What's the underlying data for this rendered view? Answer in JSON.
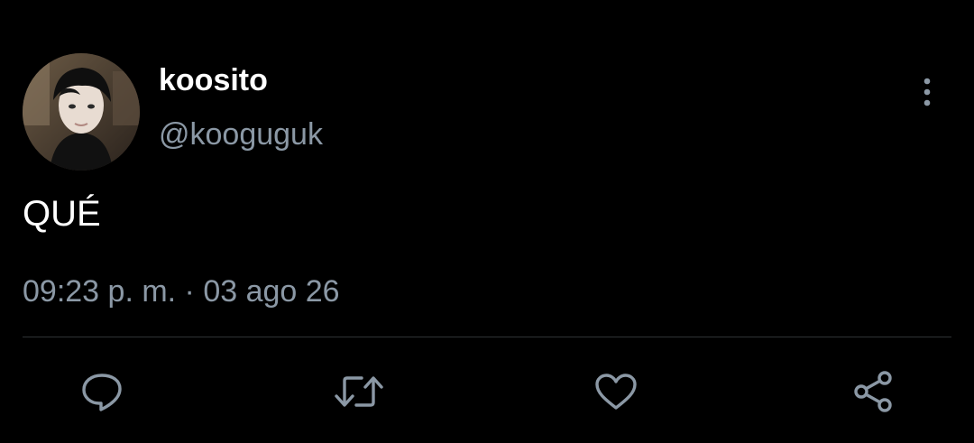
{
  "tweet": {
    "author": {
      "display_name": "koosito",
      "handle": "@kooguguk",
      "avatar_icon": "profile-photo"
    },
    "text": "QUÉ",
    "timestamp": "09:23 p. m. · 03 ago 26"
  },
  "actions": {
    "reply_icon": "comment-icon",
    "retweet_icon": "retweet-icon",
    "like_icon": "heart-icon",
    "share_icon": "share-icon",
    "more_icon": "more-vertical-icon"
  },
  "colors": {
    "background": "#000000",
    "primary_text": "#ffffff",
    "secondary_text": "#8b98a5",
    "divider": "#2f3336"
  }
}
